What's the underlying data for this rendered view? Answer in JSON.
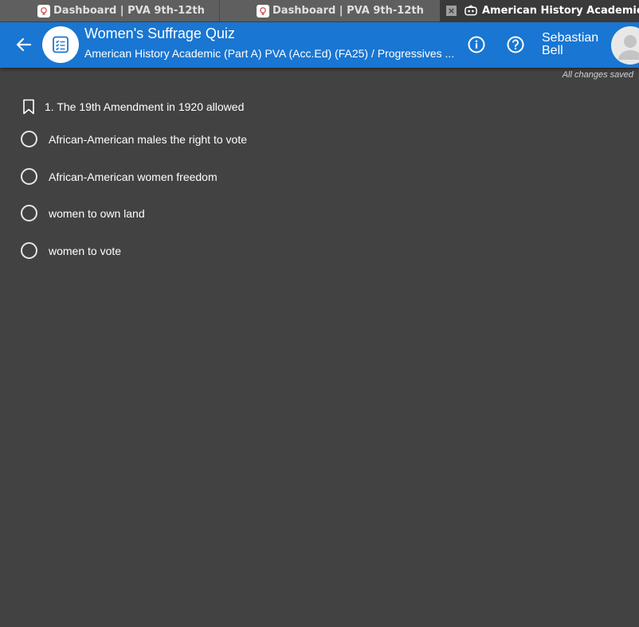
{
  "tabs": [
    {
      "title": "Dashboard | PVA 9th-12th",
      "icon": "lightbulb-icon"
    },
    {
      "title": "Dashboard | PVA 9th-12th",
      "icon": "lightbulb-icon"
    },
    {
      "title": "American History Academic (P...",
      "icon": "quiz-favicon-icon",
      "close": "×"
    }
  ],
  "header": {
    "title": "Women's Suffrage Quiz",
    "subtitle": "American History Academic (Part A) PVA (Acc.Ed) (FA25) / Progressives ...",
    "user_first": "Sebastian",
    "user_last": "Bell",
    "accent_color": "#1976d2"
  },
  "status": {
    "saved": "All changes saved"
  },
  "question": {
    "text": "1. The 19th Amendment in 1920 allowed",
    "options": [
      {
        "label": "African-American males the right to vote"
      },
      {
        "label": "African-American women freedom"
      },
      {
        "label": "women to own land"
      },
      {
        "label": "women to vote"
      }
    ]
  }
}
